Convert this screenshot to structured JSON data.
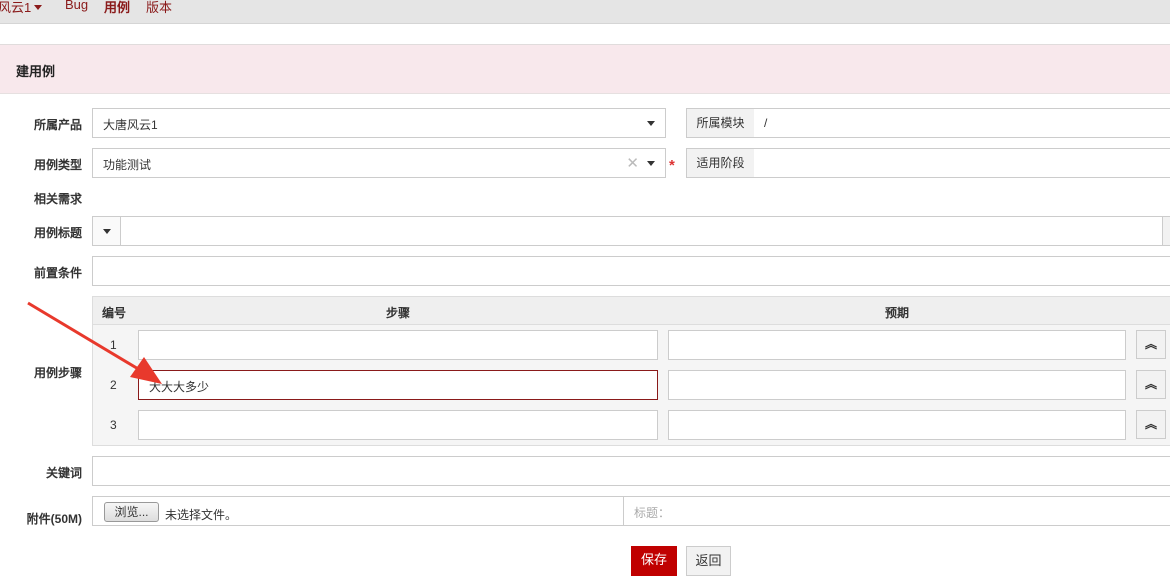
{
  "nav": {
    "items": [
      "风云1",
      "Bug",
      "用例",
      "版本"
    ],
    "active": "用例"
  },
  "page_title": "建用例",
  "form": {
    "product": {
      "label": "所属产品",
      "value": "大唐风云1"
    },
    "module": {
      "label": "所属模块",
      "value": "/"
    },
    "type": {
      "label": "用例类型",
      "value": "功能测试",
      "required": "*"
    },
    "stage": {
      "label": "适用阶段",
      "value": ""
    },
    "story": {
      "label": "相关需求"
    },
    "title": {
      "label": "用例标题",
      "value": ""
    },
    "precondition": {
      "label": "前置条件",
      "value": ""
    },
    "steps": {
      "label": "用例步骤",
      "headers": [
        "编号",
        "步骤",
        "预期"
      ],
      "rows": [
        {
          "num": "1",
          "step": "",
          "expect": ""
        },
        {
          "num": "2",
          "step": "大大大多少",
          "expect": ""
        },
        {
          "num": "3",
          "step": "",
          "expect": ""
        }
      ],
      "move_up": "«"
    },
    "keywords": {
      "label": "关键词",
      "value": ""
    },
    "attach": {
      "label": "附件(50M)",
      "browse": "浏览...",
      "no_file": "未选择文件。",
      "title_placeholder": "标题："
    }
  },
  "actions": {
    "save": "保存",
    "back": "返回"
  },
  "colors": {
    "accent": "#c00000",
    "header_bg": "#f8e8ec",
    "arrow": "#e8392c"
  }
}
